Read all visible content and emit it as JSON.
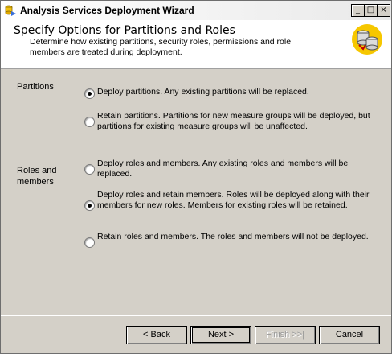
{
  "window": {
    "title": "Analysis Services Deployment Wizard",
    "controls": {
      "minimize": "_",
      "maximize": "□",
      "close": "×"
    }
  },
  "header": {
    "title": "Specify Options for Partitions and Roles",
    "description": "Determine how existing partitions, security roles, permissions and role members are treated during deployment.",
    "logo_icon": "database-icon"
  },
  "sections": {
    "partitions": {
      "label": "Partitions",
      "options": [
        {
          "label": "Deploy partitions. Any existing partitions will be replaced.",
          "selected": true
        },
        {
          "label": "Retain partitions. Partitions for new measure groups will be deployed, but partitions for existing measure groups will be unaffected.",
          "selected": false
        }
      ]
    },
    "roles": {
      "label": "Roles and members",
      "options": [
        {
          "label": "Deploy roles and members. Any existing roles and members will be replaced.",
          "selected": false
        },
        {
          "label": "Deploy roles and retain members. Roles will be deployed along with their members for new roles. Members for existing roles will be retained.",
          "selected": true
        },
        {
          "label": "Retain roles and members. The roles and members will not be deployed.",
          "selected": false
        }
      ]
    }
  },
  "footer": {
    "back": "< Back",
    "next": "Next >",
    "finish": "Finish >>|",
    "cancel": "Cancel"
  }
}
